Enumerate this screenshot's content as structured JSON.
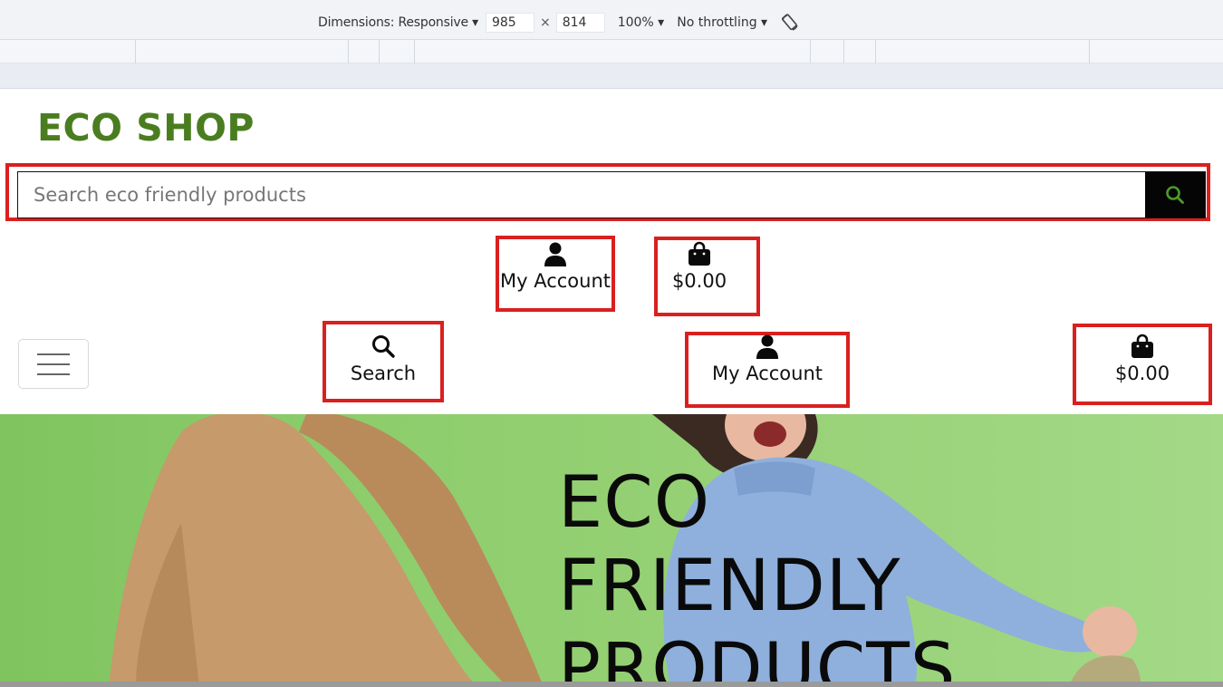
{
  "devtools": {
    "dimensions_label": "Dimensions: Responsive ▾",
    "width": "985",
    "times": "×",
    "height": "814",
    "zoom": "100% ▾",
    "throttling": "No throttling ▾",
    "rotate_icon": "rotate-icon"
  },
  "header": {
    "logo": "ECO SHOP",
    "search": {
      "placeholder": "Search eco friendly products",
      "button_icon": "search-icon",
      "button_icon_color": "#4a9c2a"
    },
    "account": {
      "label": "My Account",
      "icon": "user-icon"
    },
    "cart": {
      "label": "$0.00",
      "icon": "bag-icon"
    }
  },
  "mobile_nav": {
    "menu_icon": "hamburger-icon",
    "search": {
      "label": "Search",
      "icon": "search-icon"
    },
    "account": {
      "label": "My Account",
      "icon": "user-icon"
    },
    "cart": {
      "label": "$0.00",
      "icon": "bag-icon"
    }
  },
  "hero": {
    "title_lines": [
      "ECO",
      "FRIENDLY",
      "PRODUCTS"
    ],
    "background_color": "#8dcd6c"
  },
  "colors": {
    "highlight": "#d9201f",
    "logo": "#4a7d1f",
    "search_button": "#050505"
  }
}
